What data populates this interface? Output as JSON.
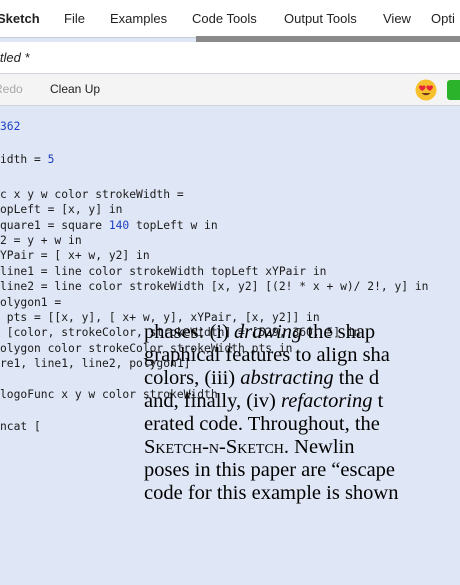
{
  "menubar": {
    "items": [
      "Sketch",
      "File",
      "Examples",
      "Code Tools",
      "Output Tools",
      "View",
      "Opti"
    ]
  },
  "document": {
    "title": "itled *"
  },
  "toolbar": {
    "redo_label": "Redo",
    "clean_up_label": "Clean Up"
  },
  "editor": {
    "lines": [
      {
        "pre": "",
        "num": "362",
        "post": ""
      },
      {
        "pre": "idth = ",
        "num": "5",
        "post": ""
      },
      {
        "pre": "c x y w color strokeWidth =",
        "num": "",
        "post": ""
      },
      {
        "pre": "opLeft = [x, y] in",
        "num": "",
        "post": ""
      },
      {
        "pre": "quare1 = square ",
        "num": "140",
        "post": " topLeft w in"
      },
      {
        "pre": "2 = y + w in",
        "num": "",
        "post": ""
      },
      {
        "pre": "YPair = [ x+ w, y2] in",
        "num": "",
        "post": ""
      },
      {
        "pre": "line1 = line color strokeWidth topLeft xYPair in",
        "num": "",
        "post": ""
      },
      {
        "pre": "line2 = line color strokeWidth [x, y2] [(2! * x + w)/ 2!, y] in",
        "num": "",
        "post": ""
      },
      {
        "pre": "olygon1 =",
        "num": "",
        "post": ""
      },
      {
        "pre": " pts = [[x, y], [ x+ w, y], xYPair, [x, y2]] in",
        "num": "",
        "post": ""
      },
      {
        "pre": " [color, strokeColor, strokeWidth] = [529, 360, 5] in",
        "num": "",
        "post": ""
      },
      {
        "pre": "olygon color strokeColor strokeWidth pts in",
        "num": "",
        "post": ""
      },
      {
        "pre": "re1, line1, line2, polygon1]",
        "num": "",
        "post": ""
      },
      {
        "pre": "",
        "num": "",
        "post": ""
      },
      {
        "pre": "logoFunc x y w color strokeWidth",
        "num": "",
        "post": ""
      },
      {
        "pre": "",
        "num": "",
        "post": ""
      },
      {
        "pre": "ncat [",
        "num": "",
        "post": ""
      }
    ]
  },
  "overlay_text": {
    "l1_a": "phases: (i) ",
    "l1_b": "drawing",
    "l1_c": " the shap",
    "l2": "graphical features to align sha",
    "l3_a": "colors, (iii) ",
    "l3_b": "abstracting",
    "l3_c": " the d",
    "l4_a": "and, finally, (iv) ",
    "l4_b": "refactoring",
    "l4_c": " t",
    "l5": "erated code. Throughout, the",
    "l6_a": "Sketch-n-Sketch",
    "l6_b": ". Newlin",
    "l7": "poses in this paper are “escape",
    "l8": "code for this example is shown"
  },
  "colors": {
    "editor_bg": "#dfe6f5",
    "number": "#1a3fc4",
    "run_button": "#2bb32b"
  },
  "icons": {
    "emoji": "heart-eyes-emoji-icon"
  }
}
